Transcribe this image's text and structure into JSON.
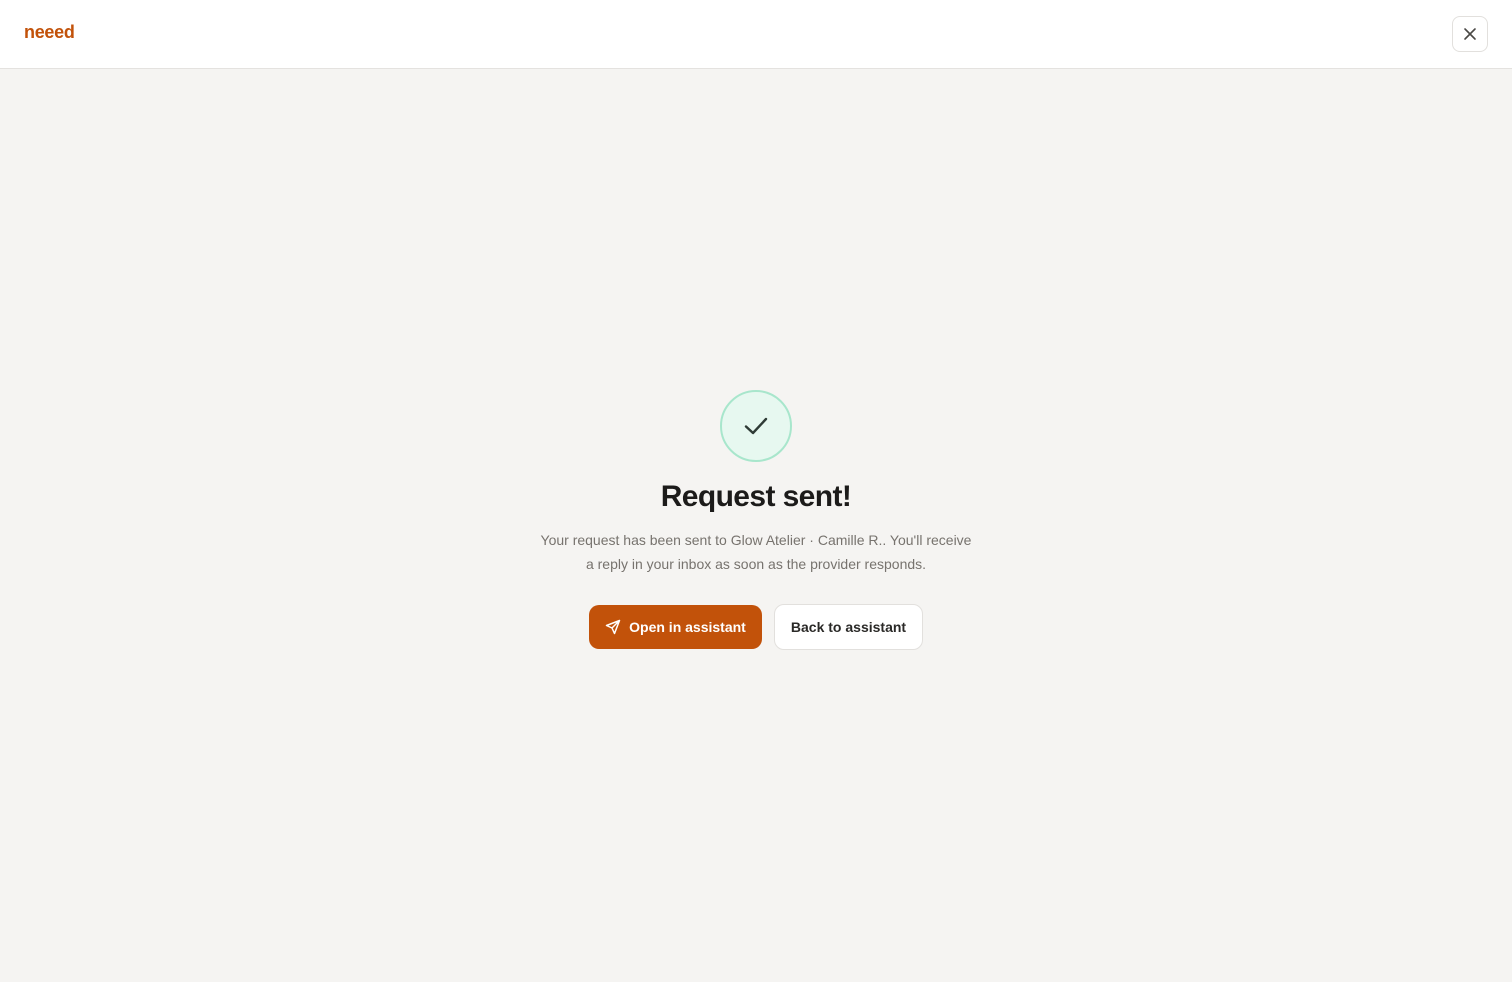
{
  "header": {
    "logo_text": "neeed",
    "close_icon": "close-icon"
  },
  "confirmation": {
    "status_icon": "checkmark-icon",
    "title": "Request sent!",
    "description": "Your request has been sent to Glow Atelier · Camille R.. You'll receive a reply in your inbox as soon as the provider responds."
  },
  "actions": {
    "primary_label": "Open in assistant",
    "primary_icon": "send-icon",
    "secondary_label": "Back to assistant"
  },
  "colors": {
    "brand": "#c2520a",
    "success_bg": "#e7f8f0",
    "success_border": "#a8e6cc",
    "page_bg": "#f5f4f2"
  }
}
